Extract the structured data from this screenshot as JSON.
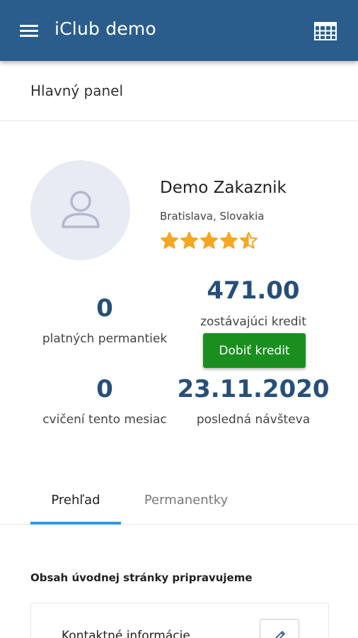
{
  "header": {
    "title": "iClub demo",
    "menu_icon": "hamburger-menu-icon",
    "calendar_icon": "calendar-grid-icon",
    "bg_color": "#2a5d8c"
  },
  "page": {
    "title": "Hlavný panel"
  },
  "profile": {
    "name": "Demo Zakaznik",
    "location": "Bratislava, Slovakia",
    "rating": 4.5,
    "rating_max": 5,
    "avatar_icon": "user-avatar-icon",
    "star_color": "#f5a623"
  },
  "stats": {
    "permits_count": "0",
    "permits_label": "platných permantiek",
    "credit_value": "471.00",
    "credit_label": "zostávajúci kredit",
    "topup_label": "Dobiť kredit",
    "workouts_count": "0",
    "workouts_label": "cvičení tento mesiac",
    "last_visit_value": "23.11.2020",
    "last_visit_label": "posledná návšteva"
  },
  "tabs": [
    {
      "label": "Prehľad",
      "active": true
    },
    {
      "label": "Permanentky",
      "active": false
    }
  ],
  "content": {
    "note": "Obsah úvodnej stránky pripravujeme",
    "card_title": "Kontaktné informácie",
    "edit_icon": "pencil-icon"
  },
  "colors": {
    "accent": "#264f7a",
    "button_green": "#1a8f1f",
    "tab_indicator": "#2b9af0"
  }
}
